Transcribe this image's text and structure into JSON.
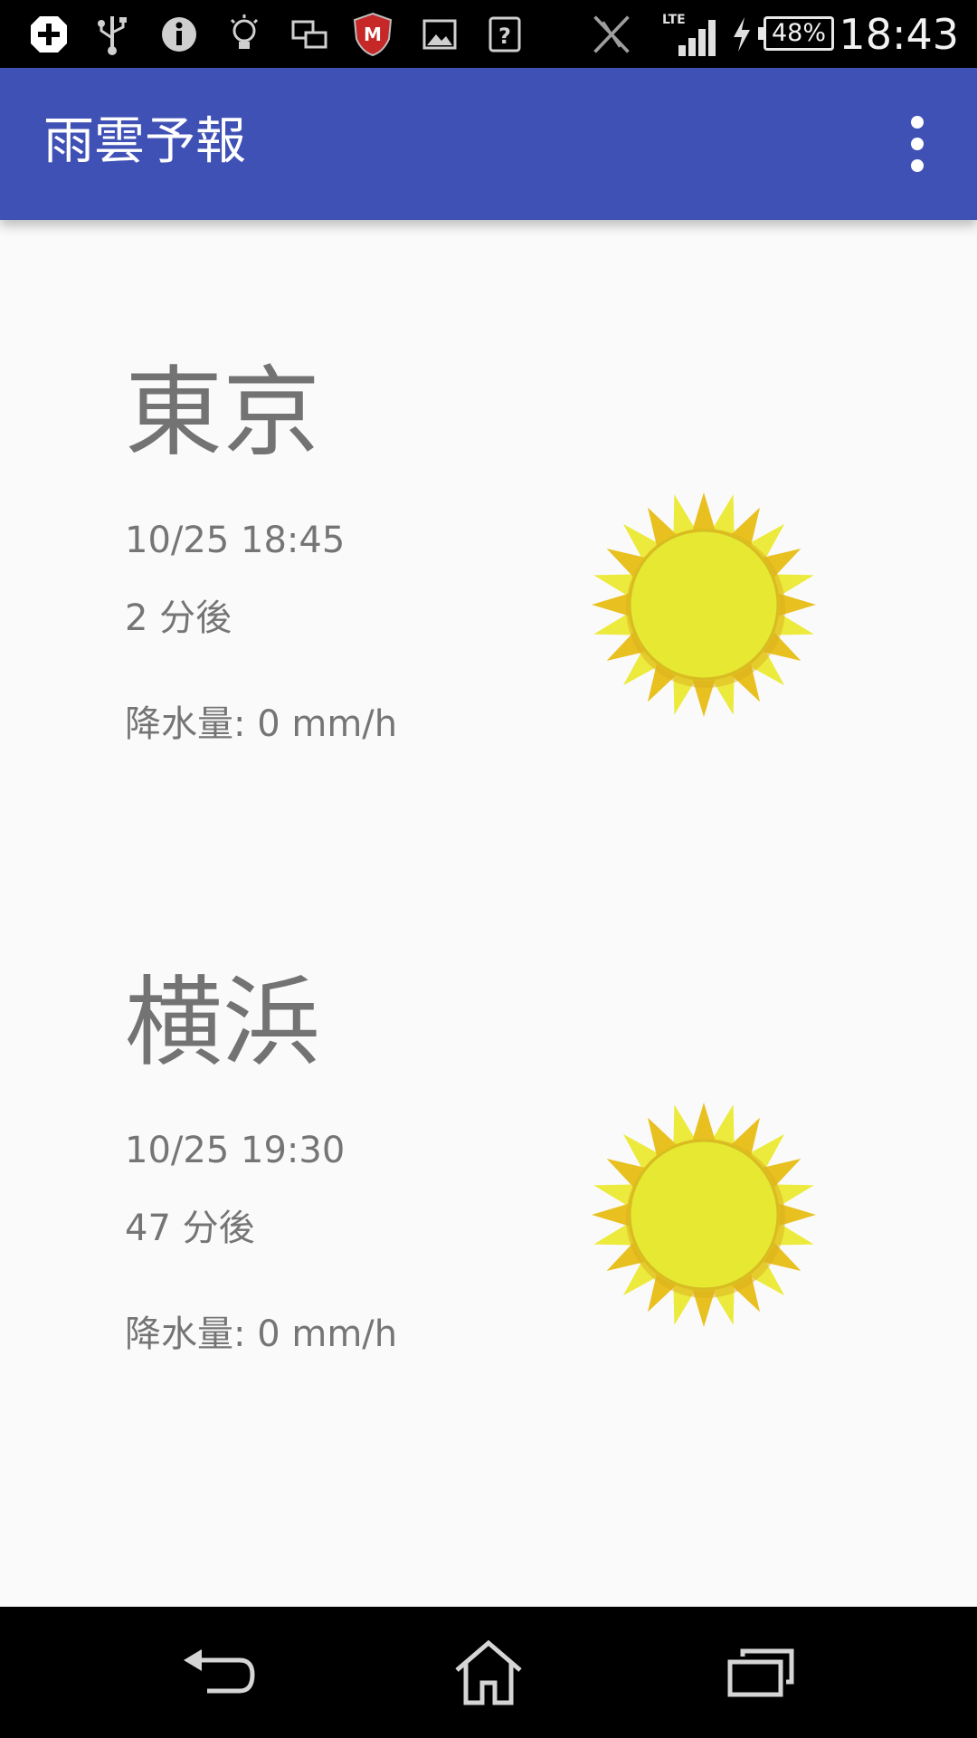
{
  "status_bar": {
    "time": "18:43",
    "battery_percent": "48%",
    "network": "LTE",
    "icons": [
      "plus-badge-icon",
      "usb-icon",
      "info-icon",
      "bulb-icon",
      "screen-mirror-icon",
      "mcafee-icon",
      "image-icon",
      "question-icon",
      "no-nfc-icon",
      "signal-icon",
      "charging-icon"
    ]
  },
  "app_bar": {
    "title": "雨雲予報",
    "overflow_icon": "more-vert-icon",
    "color": "#3f51b5"
  },
  "forecasts": [
    {
      "city": "東京",
      "datetime": "10/25 18:45",
      "minutes_after": "2 分後",
      "precipitation": "降水量: 0 mm/h",
      "weather_icon": "sun-icon"
    },
    {
      "city": "横浜",
      "datetime": "10/25 19:30",
      "minutes_after": "47 分後",
      "precipitation": "降水量: 0 mm/h",
      "weather_icon": "sun-icon"
    }
  ],
  "nav_bar": {
    "buttons": [
      "back-icon",
      "home-icon",
      "recents-icon"
    ]
  },
  "colors": {
    "sun_outer": "#e8c020",
    "sun_inner": "#e6e832",
    "text_gray": "#757575"
  }
}
